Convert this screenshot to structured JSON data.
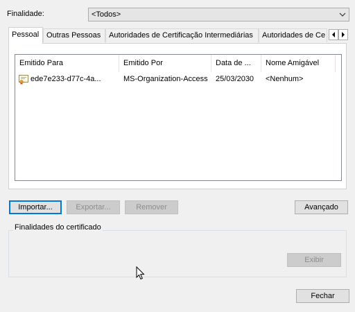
{
  "purpose": {
    "label": "Finalidade:",
    "selected": "<Todos>"
  },
  "tabs": [
    {
      "label": "Pessoal",
      "active": true
    },
    {
      "label": "Outras Pessoas"
    },
    {
      "label": "Autoridades de Certificação Intermediárias"
    },
    {
      "label": "Autoridades de Ce"
    }
  ],
  "list": {
    "columns": [
      "Emitido Para",
      "Emitido Por",
      "Data de ...",
      "Nome Amigável"
    ],
    "rows": [
      {
        "issued_to": "ede7e233-d77c-4a...",
        "issued_by": "MS-Organization-Access",
        "date": "25/03/2030",
        "friendly_name": "<Nenhum>"
      }
    ]
  },
  "buttons": {
    "import": "Importar...",
    "export": "Exportar...",
    "remove": "Remover",
    "advanced": "Avançado",
    "view": "Exibir",
    "close": "Fechar"
  },
  "purposes_group": {
    "title": "Finalidades do certificado"
  },
  "colors": {
    "background": "#f0f0f0",
    "focus_border": "#0078d7"
  }
}
